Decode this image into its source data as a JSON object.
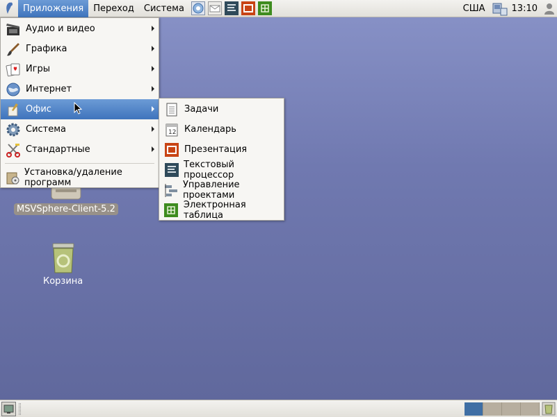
{
  "top_panel": {
    "menus": [
      "Приложения",
      "Переход",
      "Система"
    ],
    "keyboard_layout": "США",
    "clock": "13:10"
  },
  "desktop": {
    "icons": [
      {
        "label": "MSVSphere-Client-5.2",
        "icon": "disc-drive-icon"
      },
      {
        "label": "Корзина",
        "icon": "trash-icon"
      }
    ]
  },
  "applications_menu": {
    "items": [
      {
        "label": "Аудио и видео",
        "icon": "clapperboard-icon",
        "submenu": true
      },
      {
        "label": "Графика",
        "icon": "paintbrush-icon",
        "submenu": true
      },
      {
        "label": "Игры",
        "icon": "playing-cards-icon",
        "submenu": true
      },
      {
        "label": "Интернет",
        "icon": "globe-icon",
        "submenu": true
      },
      {
        "label": "Офис",
        "icon": "office-icon",
        "submenu": true,
        "highlighted": true
      },
      {
        "label": "Система",
        "icon": "gear-icon",
        "submenu": true
      },
      {
        "label": "Стандартные",
        "icon": "scissors-icon",
        "submenu": true
      },
      {
        "label": "Установка/удаление программ",
        "icon": "install-software-icon",
        "submenu": false
      }
    ]
  },
  "office_submenu": {
    "items": [
      {
        "label": "Задачи",
        "icon": "notepad-icon"
      },
      {
        "label": "Календарь",
        "icon": "calendar-icon"
      },
      {
        "label": "Презентация",
        "icon": "presentation-icon"
      },
      {
        "label": "Текстовый процессор",
        "icon": "writer-icon"
      },
      {
        "label": "Управление проектами",
        "icon": "project-icon"
      },
      {
        "label": "Электронная таблица",
        "icon": "spreadsheet-icon"
      }
    ]
  },
  "colors": {
    "highlight": "#3f74bc",
    "desktop_top": "#8993c8",
    "desktop_bottom": "#5f679b"
  },
  "workspaces": {
    "count": 4,
    "active": 1
  }
}
